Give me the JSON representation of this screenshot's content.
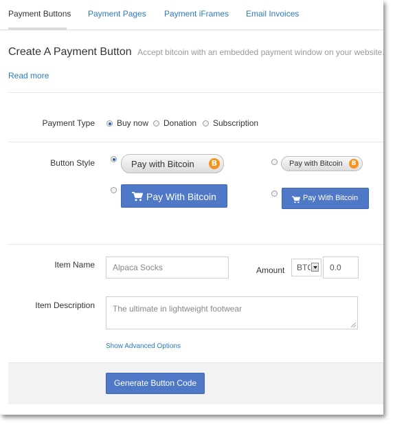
{
  "tabs": [
    {
      "label": "Payment Buttons",
      "active": true
    },
    {
      "label": "Payment Pages",
      "active": false
    },
    {
      "label": "Payment iFrames",
      "active": false
    },
    {
      "label": "Email Invoices",
      "active": false
    }
  ],
  "header": {
    "title": "Create A Payment Button",
    "subtitle": "Accept bitcoin with an embedded payment window on your website.",
    "read_more": "Read more"
  },
  "payment_type": {
    "label": "Payment Type",
    "selected": "Buy now",
    "options": [
      "Buy now",
      "Donation",
      "Subscription"
    ]
  },
  "button_style": {
    "label": "Button Style",
    "selected_index": 0,
    "options": [
      {
        "text": "Pay with Bitcoin",
        "style": "pill-large",
        "icon": "bitcoin-coin-icon"
      },
      {
        "text": "Pay with Bitcoin",
        "style": "pill-small",
        "icon": "bitcoin-coin-icon"
      },
      {
        "text": "Pay With Bitcoin",
        "style": "blue-large",
        "icon": "cart-icon"
      },
      {
        "text": "Pay With Bitcoin",
        "style": "blue-small",
        "icon": "cart-icon"
      }
    ],
    "coin_symbol": "B"
  },
  "item": {
    "name_label": "Item Name",
    "name_placeholder": "Alpaca Socks",
    "amount_label": "Amount",
    "currency": "BTC",
    "amount_value": "0.0",
    "description_label": "Item Description",
    "description_placeholder": "The ultimate in lightweight footwear"
  },
  "advanced_link": "Show Advanced Options",
  "generate_button": "Generate Button Code",
  "colors": {
    "link": "#2a7ac0",
    "primary_button": "#4f78c6",
    "bitcoin_orange": "#f7931a"
  }
}
